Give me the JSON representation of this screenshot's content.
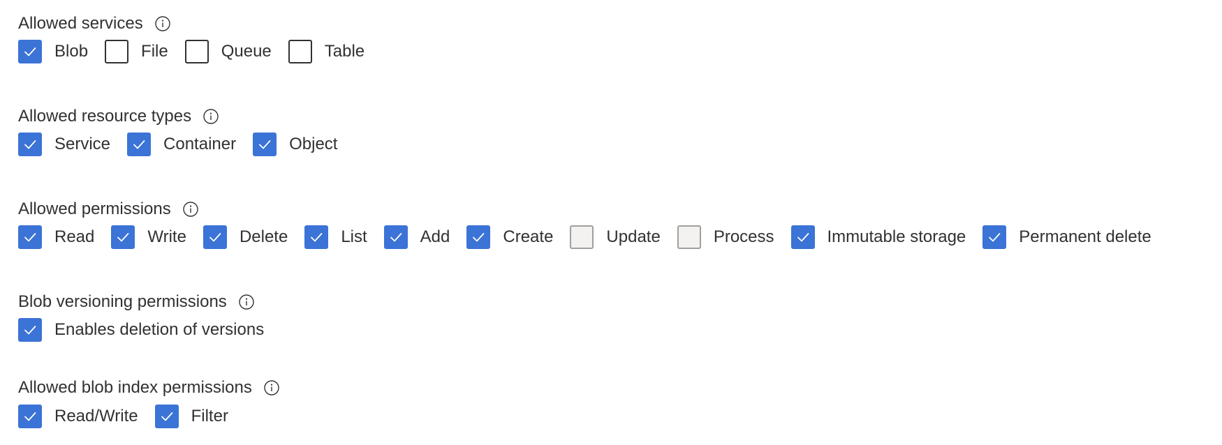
{
  "sections": [
    {
      "label": "Allowed services",
      "items": [
        {
          "label": "Blob",
          "state": "checked"
        },
        {
          "label": "File",
          "state": "unchecked"
        },
        {
          "label": "Queue",
          "state": "unchecked"
        },
        {
          "label": "Table",
          "state": "unchecked"
        }
      ]
    },
    {
      "label": "Allowed resource types",
      "items": [
        {
          "label": "Service",
          "state": "checked"
        },
        {
          "label": "Container",
          "state": "checked"
        },
        {
          "label": "Object",
          "state": "checked"
        }
      ]
    },
    {
      "label": "Allowed permissions",
      "items": [
        {
          "label": "Read",
          "state": "checked"
        },
        {
          "label": "Write",
          "state": "checked"
        },
        {
          "label": "Delete",
          "state": "checked"
        },
        {
          "label": "List",
          "state": "checked"
        },
        {
          "label": "Add",
          "state": "checked"
        },
        {
          "label": "Create",
          "state": "checked"
        },
        {
          "label": "Update",
          "state": "disabled"
        },
        {
          "label": "Process",
          "state": "disabled"
        },
        {
          "label": "Immutable storage",
          "state": "checked"
        },
        {
          "label": "Permanent delete",
          "state": "checked"
        }
      ]
    },
    {
      "label": "Blob versioning permissions",
      "items": [
        {
          "label": "Enables deletion of versions",
          "state": "checked"
        }
      ]
    },
    {
      "label": "Allowed blob index permissions",
      "items": [
        {
          "label": "Read/Write",
          "state": "checked"
        },
        {
          "label": "Filter",
          "state": "checked"
        }
      ]
    }
  ],
  "icons": {
    "info": "info-icon",
    "check": "checkmark-icon"
  },
  "colors": {
    "checked_fill": "#3b73d6",
    "text": "#323130",
    "unchecked_border": "#323130",
    "disabled_fill": "#f3f2f1",
    "disabled_border": "#a19f9d"
  }
}
